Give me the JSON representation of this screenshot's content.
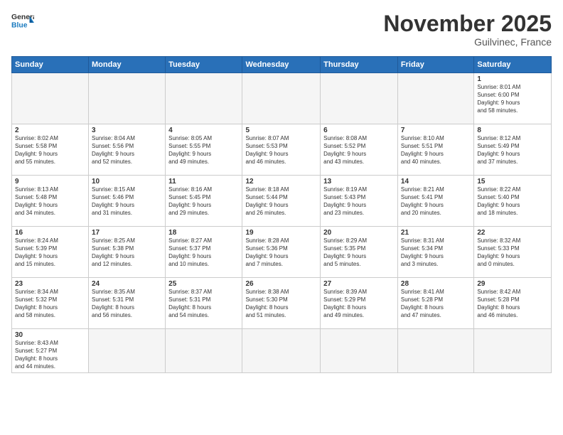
{
  "header": {
    "logo_general": "General",
    "logo_blue": "Blue",
    "month_title": "November 2025",
    "location": "Guilvinec, France"
  },
  "days_of_week": [
    "Sunday",
    "Monday",
    "Tuesday",
    "Wednesday",
    "Thursday",
    "Friday",
    "Saturday"
  ],
  "weeks": [
    [
      {
        "day": "",
        "info": ""
      },
      {
        "day": "",
        "info": ""
      },
      {
        "day": "",
        "info": ""
      },
      {
        "day": "",
        "info": ""
      },
      {
        "day": "",
        "info": ""
      },
      {
        "day": "",
        "info": ""
      },
      {
        "day": "1",
        "info": "Sunrise: 8:01 AM\nSunset: 6:00 PM\nDaylight: 9 hours\nand 58 minutes."
      }
    ],
    [
      {
        "day": "2",
        "info": "Sunrise: 8:02 AM\nSunset: 5:58 PM\nDaylight: 9 hours\nand 55 minutes."
      },
      {
        "day": "3",
        "info": "Sunrise: 8:04 AM\nSunset: 5:56 PM\nDaylight: 9 hours\nand 52 minutes."
      },
      {
        "day": "4",
        "info": "Sunrise: 8:05 AM\nSunset: 5:55 PM\nDaylight: 9 hours\nand 49 minutes."
      },
      {
        "day": "5",
        "info": "Sunrise: 8:07 AM\nSunset: 5:53 PM\nDaylight: 9 hours\nand 46 minutes."
      },
      {
        "day": "6",
        "info": "Sunrise: 8:08 AM\nSunset: 5:52 PM\nDaylight: 9 hours\nand 43 minutes."
      },
      {
        "day": "7",
        "info": "Sunrise: 8:10 AM\nSunset: 5:51 PM\nDaylight: 9 hours\nand 40 minutes."
      },
      {
        "day": "8",
        "info": "Sunrise: 8:12 AM\nSunset: 5:49 PM\nDaylight: 9 hours\nand 37 minutes."
      }
    ],
    [
      {
        "day": "9",
        "info": "Sunrise: 8:13 AM\nSunset: 5:48 PM\nDaylight: 9 hours\nand 34 minutes."
      },
      {
        "day": "10",
        "info": "Sunrise: 8:15 AM\nSunset: 5:46 PM\nDaylight: 9 hours\nand 31 minutes."
      },
      {
        "day": "11",
        "info": "Sunrise: 8:16 AM\nSunset: 5:45 PM\nDaylight: 9 hours\nand 29 minutes."
      },
      {
        "day": "12",
        "info": "Sunrise: 8:18 AM\nSunset: 5:44 PM\nDaylight: 9 hours\nand 26 minutes."
      },
      {
        "day": "13",
        "info": "Sunrise: 8:19 AM\nSunset: 5:43 PM\nDaylight: 9 hours\nand 23 minutes."
      },
      {
        "day": "14",
        "info": "Sunrise: 8:21 AM\nSunset: 5:41 PM\nDaylight: 9 hours\nand 20 minutes."
      },
      {
        "day": "15",
        "info": "Sunrise: 8:22 AM\nSunset: 5:40 PM\nDaylight: 9 hours\nand 18 minutes."
      }
    ],
    [
      {
        "day": "16",
        "info": "Sunrise: 8:24 AM\nSunset: 5:39 PM\nDaylight: 9 hours\nand 15 minutes."
      },
      {
        "day": "17",
        "info": "Sunrise: 8:25 AM\nSunset: 5:38 PM\nDaylight: 9 hours\nand 12 minutes."
      },
      {
        "day": "18",
        "info": "Sunrise: 8:27 AM\nSunset: 5:37 PM\nDaylight: 9 hours\nand 10 minutes."
      },
      {
        "day": "19",
        "info": "Sunrise: 8:28 AM\nSunset: 5:36 PM\nDaylight: 9 hours\nand 7 minutes."
      },
      {
        "day": "20",
        "info": "Sunrise: 8:29 AM\nSunset: 5:35 PM\nDaylight: 9 hours\nand 5 minutes."
      },
      {
        "day": "21",
        "info": "Sunrise: 8:31 AM\nSunset: 5:34 PM\nDaylight: 9 hours\nand 3 minutes."
      },
      {
        "day": "22",
        "info": "Sunrise: 8:32 AM\nSunset: 5:33 PM\nDaylight: 9 hours\nand 0 minutes."
      }
    ],
    [
      {
        "day": "23",
        "info": "Sunrise: 8:34 AM\nSunset: 5:32 PM\nDaylight: 8 hours\nand 58 minutes."
      },
      {
        "day": "24",
        "info": "Sunrise: 8:35 AM\nSunset: 5:31 PM\nDaylight: 8 hours\nand 56 minutes."
      },
      {
        "day": "25",
        "info": "Sunrise: 8:37 AM\nSunset: 5:31 PM\nDaylight: 8 hours\nand 54 minutes."
      },
      {
        "day": "26",
        "info": "Sunrise: 8:38 AM\nSunset: 5:30 PM\nDaylight: 8 hours\nand 51 minutes."
      },
      {
        "day": "27",
        "info": "Sunrise: 8:39 AM\nSunset: 5:29 PM\nDaylight: 8 hours\nand 49 minutes."
      },
      {
        "day": "28",
        "info": "Sunrise: 8:41 AM\nSunset: 5:28 PM\nDaylight: 8 hours\nand 47 minutes."
      },
      {
        "day": "29",
        "info": "Sunrise: 8:42 AM\nSunset: 5:28 PM\nDaylight: 8 hours\nand 46 minutes."
      }
    ],
    [
      {
        "day": "30",
        "info": "Sunrise: 8:43 AM\nSunset: 5:27 PM\nDaylight: 8 hours\nand 44 minutes."
      },
      {
        "day": "",
        "info": ""
      },
      {
        "day": "",
        "info": ""
      },
      {
        "day": "",
        "info": ""
      },
      {
        "day": "",
        "info": ""
      },
      {
        "day": "",
        "info": ""
      },
      {
        "day": "",
        "info": ""
      }
    ]
  ]
}
